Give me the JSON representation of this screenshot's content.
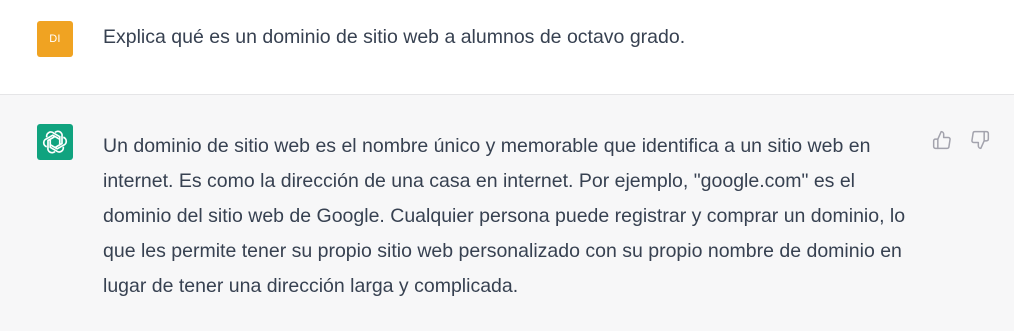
{
  "user_message": {
    "avatar_initials": "DI",
    "avatar_color": "#f0a322",
    "text": "Explica qué es un dominio de sitio web a alumnos de octavo grado."
  },
  "assistant_message": {
    "avatar_icon": "openai-logo-icon",
    "avatar_color": "#10a37f",
    "text": "Un dominio de sitio web es el nombre único y memorable que identifica a un sitio web en internet. Es como la dirección de una casa en internet. Por ejemplo, \"google.com\" es el dominio del sitio web de Google. Cualquier persona puede registrar y comprar un dominio, lo que les permite tener su propio sitio web personalizado con su propio nombre de dominio en lugar de tener una dirección larga y complicada.",
    "feedback": {
      "thumbs_up_icon": "thumbs-up-icon",
      "thumbs_down_icon": "thumbs-down-icon"
    }
  }
}
